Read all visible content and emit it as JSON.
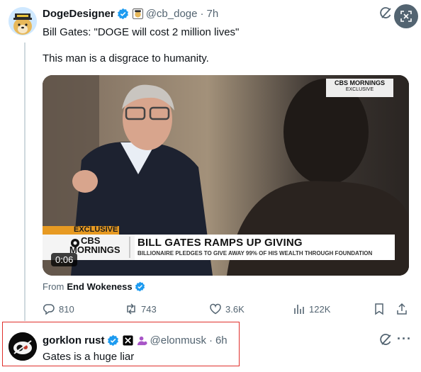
{
  "tweet": {
    "author_name": "DogeDesigner",
    "author_handle": "@cb_doge",
    "time": "7h",
    "text_line1": "Bill Gates: \"DOGE will cost 2 million lives\"",
    "text_line2": "This man is a disgrace to humanity.",
    "media": {
      "network_top": "CBS MORNINGS",
      "top_sub": "EXCLUSIVE",
      "exclusive_tag": "EXCLUSIVE",
      "logo_line1": "CBS",
      "logo_line2": "MORNINGS",
      "headline": "BILL GATES RAMPS UP GIVING",
      "subheadline": "BILLIONAIRE PLEDGES TO GIVE AWAY 99% OF HIS WEALTH THROUGH FOUNDATION",
      "duration": "0:06"
    },
    "from_prefix": "From",
    "from_account": "End Wokeness",
    "replies": "810",
    "reposts": "743",
    "likes": "3.6K",
    "views": "122K"
  },
  "reply": {
    "author_name": "gorklon rust",
    "author_handle": "@elonmusk",
    "time": "6h",
    "text": "Gates is a huge liar"
  },
  "colors": {
    "verified": "#1d9bf0",
    "highlight_border": "#e0302c",
    "muted": "#536471"
  }
}
